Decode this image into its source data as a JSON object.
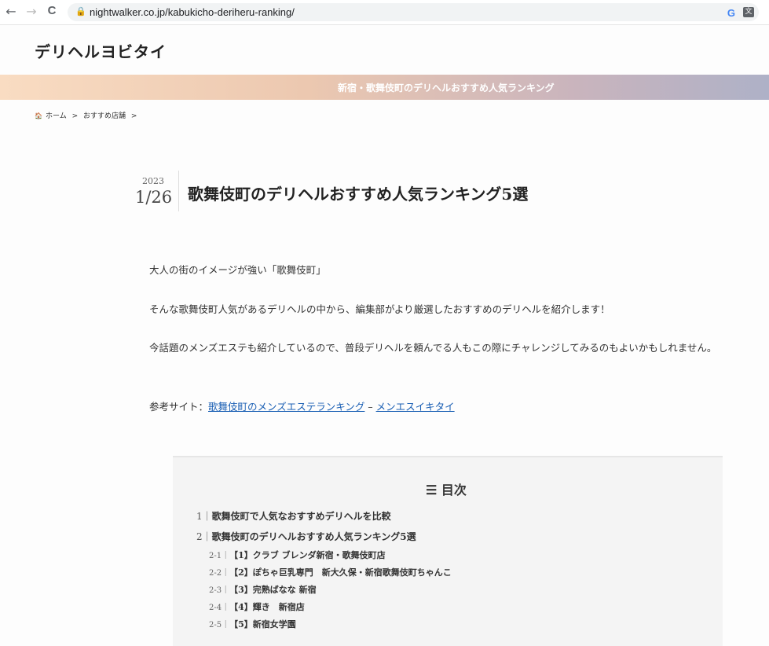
{
  "browser": {
    "url": "nightwalker.co.jp/kabukicho-deriheru-ranking/",
    "back": "←",
    "forward": "→",
    "reload": "C",
    "lock": "🔒",
    "g": "G",
    "translate": "文"
  },
  "site": {
    "title": "デリヘルヨビタイ",
    "banner": "新宿・歌舞伎町のデリヘルおすすめ人気ランキング"
  },
  "breadcrumb": {
    "home_icon": "🏠",
    "home": "ホーム",
    "sep": ">",
    "category": "おすすめ店舗"
  },
  "article": {
    "year": "2023",
    "month_day": "1/26",
    "title": "歌舞伎町のデリヘルおすすめ人気ランキング5選",
    "p1": "大人の街のイメージが強い「歌舞伎町」",
    "p2": "そんな歌舞伎町人気があるデリヘルの中から、編集部がより厳選したおすすめのデリヘルを紹介します！",
    "p3": "今話題のメンズエステも紹介しているので、普段デリヘルを頼んでる人もこの際にチャレンジしてみるのもよいかもしれません。",
    "ref_label": "参考サイト：",
    "ref_link1": "歌舞伎町のメンズエステランキング",
    "ref_dash": " – ",
    "ref_link2": "メンエスイキタイ"
  },
  "toc": {
    "icon": "☰",
    "title": "目次",
    "items": [
      {
        "num": "1｜",
        "label": "歌舞伎町で人気なおすすめデリヘルを比較"
      },
      {
        "num": "2｜",
        "label": "歌舞伎町のデリヘルおすすめ人気ランキング5選"
      }
    ],
    "subs": [
      {
        "num": "2-1｜",
        "label": "【1】クラブ ブレンダ新宿・歌舞伎町店"
      },
      {
        "num": "2-2｜",
        "label": "【2】ぽちゃ巨乳専門　新大久保・新宿歌舞伎町ちゃんこ"
      },
      {
        "num": "2-3｜",
        "label": "【3】完熟ばなな 新宿"
      },
      {
        "num": "2-4｜",
        "label": "【4】輝き　新宿店"
      },
      {
        "num": "2-5｜",
        "label": "【5】新宿女学園"
      }
    ]
  }
}
